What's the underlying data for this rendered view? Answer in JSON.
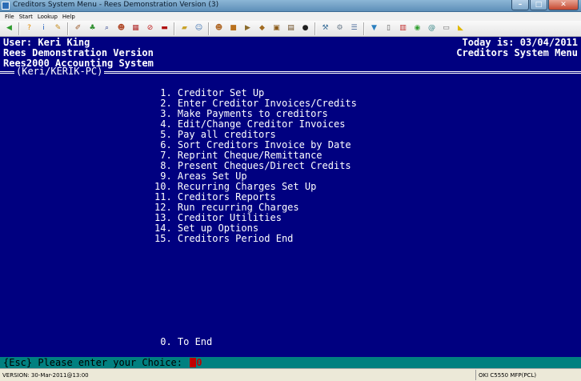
{
  "window": {
    "title": "Creditors System Menu - Rees Demonstration Version (3)",
    "minimize": "–",
    "maximize": "□",
    "close": "✕"
  },
  "menubar": {
    "items": [
      "File",
      "Start",
      "Lookup",
      "Help"
    ]
  },
  "toolbar": {
    "icons": [
      {
        "name": "back-arrow-icon",
        "glyph": "◀",
        "color": "#2e9b2e"
      },
      {
        "name": "help-icon",
        "glyph": "?",
        "color": "#e08a00"
      },
      {
        "name": "info-icon",
        "glyph": "i",
        "color": "#1f5fbf"
      },
      {
        "name": "notes-icon",
        "glyph": "✎",
        "color": "#c58a1a"
      },
      {
        "name": "edit-icon",
        "glyph": "✐",
        "color": "#9a5a2a"
      },
      {
        "name": "plant-icon",
        "glyph": "♣",
        "color": "#2f8f2f"
      },
      {
        "name": "search-icon",
        "glyph": "⌕",
        "color": "#2a3f8f"
      },
      {
        "name": "user-icon",
        "glyph": "☻",
        "color": "#b04a2a"
      },
      {
        "name": "calendar-icon",
        "glyph": "▦",
        "color": "#b02a2a"
      },
      {
        "name": "stop-icon",
        "glyph": "⊘",
        "color": "#c02020"
      },
      {
        "name": "book-icon",
        "glyph": "▬",
        "color": "#b01010"
      },
      {
        "name": "folder-icon",
        "glyph": "▰",
        "color": "#c9a227"
      },
      {
        "name": "people-icon",
        "glyph": "☺",
        "color": "#3a6fb0"
      },
      {
        "name": "group-icon",
        "glyph": "☻",
        "color": "#b06a2a"
      },
      {
        "name": "box-icon",
        "glyph": "■",
        "color": "#b8701c"
      },
      {
        "name": "truck-icon",
        "glyph": "▶",
        "color": "#8a6a2a"
      },
      {
        "name": "package-icon",
        "glyph": "◆",
        "color": "#a06a20"
      },
      {
        "name": "shipment-icon",
        "glyph": "▣",
        "color": "#8a5a18"
      },
      {
        "name": "ledger-icon",
        "glyph": "▤",
        "color": "#6a4a20"
      },
      {
        "name": "wheel-icon",
        "glyph": "●",
        "color": "#202020"
      },
      {
        "name": "wrench-icon",
        "glyph": "⚒",
        "color": "#3a6f9a"
      },
      {
        "name": "tools-icon",
        "glyph": "⚙",
        "color": "#6a7a8a"
      },
      {
        "name": "form-icon",
        "glyph": "☰",
        "color": "#4a6a9a"
      },
      {
        "name": "funnel-icon",
        "glyph": "▼",
        "color": "#2a7fbf"
      },
      {
        "name": "document-icon",
        "glyph": "▯",
        "color": "#606060"
      },
      {
        "name": "report-icon",
        "glyph": "▥",
        "color": "#c02a2a"
      },
      {
        "name": "globe-icon",
        "glyph": "◉",
        "color": "#2f9f2f"
      },
      {
        "name": "email-icon",
        "glyph": "@",
        "color": "#2a7f7f"
      },
      {
        "name": "bus-icon",
        "glyph": "▭",
        "color": "#707070"
      },
      {
        "name": "logo-icon",
        "glyph": "◣",
        "color": "#e0b800"
      }
    ]
  },
  "header": {
    "user": "User: Keri King",
    "version": "Rees Demonstration Version",
    "system": "Rees2000 Accounting System",
    "today": "Today is: 03/04/2011",
    "menu_name": "Creditors System Menu",
    "session": "(Keri/KERIK-PC)"
  },
  "menu": {
    "items": [
      " 1. Creditor Set Up",
      " 2. Enter Creditor Invoices/Credits",
      " 3. Make Payments to creditors",
      " 4. Edit/Change Creditor Invoices",
      " 5. Pay all creditors",
      " 6. Sort Creditors Invoice by Date",
      " 7. Reprint Cheque/Remittance",
      " 8. Present Cheques/Direct Credits",
      " 9. Areas Set Up",
      "10. Recurring Charges Set Up",
      "11. Creditors Reports",
      "12. Run recurring Charges",
      "13. Creditor Utilities",
      "14. Set up Options",
      "15. Creditors Period End"
    ],
    "end": " 0. To End"
  },
  "prompt": {
    "text": "{Esc} Please enter your Choice:",
    "value": "0"
  },
  "statusbar": {
    "version": "VERSION: 30-Mar-2011@13:00",
    "printer": "OKI C5550 MFP(PCL)"
  },
  "colors": {
    "terminal_bg": "#000080",
    "terminal_fg": "#ffffff",
    "prompt_bg": "#008080",
    "choice_red": "#c00000"
  }
}
